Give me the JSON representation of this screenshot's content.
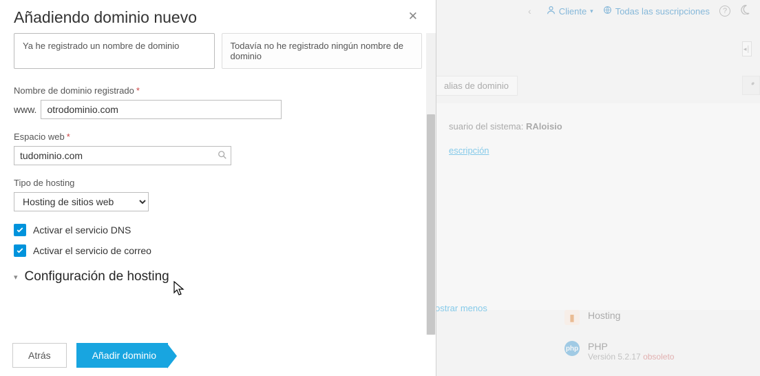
{
  "modal": {
    "title": "Añadiendo dominio nuevo",
    "option_left": "Ya he registrado un nombre de dominio",
    "option_right": "Todavía no he registrado ningún nombre de dominio",
    "domain_label": "Nombre de dominio registrado",
    "domain_prefix": "www.",
    "domain_value": "otrodominio.com",
    "webspace_label": "Espacio web",
    "webspace_value": "tudominio.com",
    "hosting_type_label": "Tipo de hosting",
    "hosting_type_value": "Hosting de sitios web",
    "dns_label": "Activar el servicio DNS",
    "mail_label": "Activar el servicio de correo",
    "section_title": "Configuración de hosting",
    "back_label": "Atrás",
    "submit_label": "Añadir dominio"
  },
  "topbar": {
    "client_label": "Cliente",
    "subs_label": "Todas las suscripciones"
  },
  "bg": {
    "tab_alias": "alias de dominio",
    "sysuser_label": "suario del sistema:",
    "sysuser_value": "RAloisio",
    "desc_link": "escripción",
    "show_less": "ostrar menos",
    "feat_hosting": "Hosting",
    "feat_php": "PHP",
    "php_version_prefix": "Versión 5.2.17",
    "php_obsolete": "obsoleto"
  }
}
